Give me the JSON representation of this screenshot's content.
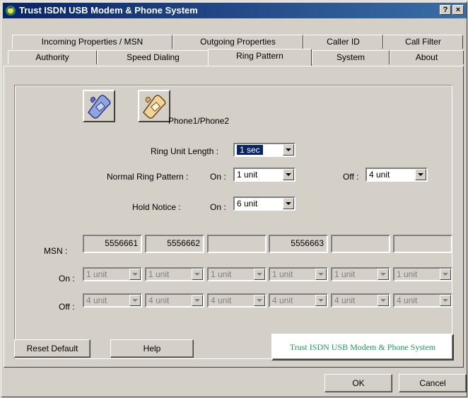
{
  "window": {
    "title": "Trust ISDN USB Modem & Phone System",
    "help_button": "?",
    "close_button": "×"
  },
  "tabs_row1": [
    "Incoming Properties / MSN",
    "Outgoing Properties",
    "Caller ID",
    "Call Filter"
  ],
  "tabs_row2": [
    "Authority",
    "Speed Dialing",
    "Ring Pattern",
    "System",
    "About"
  ],
  "active_tab": "Ring Pattern",
  "phone_label": "Phone1/Phone2",
  "ring_unit": {
    "label": "Ring Unit Length :",
    "value": "1 sec"
  },
  "normal_ring": {
    "label": "Normal Ring Pattern :",
    "on_label": "On :",
    "on_value": "1 unit",
    "off_label": "Off :",
    "off_value": "4 unit"
  },
  "hold_notice": {
    "label": "Hold Notice :",
    "on_label": "On :",
    "on_value": "6 unit"
  },
  "msn": {
    "label": "MSN :",
    "values": [
      "5556661",
      "5556662",
      "",
      "5556663",
      "",
      ""
    ],
    "on_label": "On :",
    "on_values": [
      "1 unit",
      "1 unit",
      "1 unit",
      "1 unit",
      "1 unit",
      "1 unit"
    ],
    "off_label": "Off :",
    "off_values": [
      "4 unit",
      "4 unit",
      "4 unit",
      "4 unit",
      "4 unit",
      "4 unit"
    ]
  },
  "buttons": {
    "reset": "Reset Default",
    "help": "Help",
    "banner": "Trust ISDN USB Modem & Phone System",
    "ok": "OK",
    "cancel": "Cancel"
  },
  "colors": {
    "titlebar": "#0a246a",
    "face": "#d4d0c8",
    "banner_text": "#1a9a5a"
  }
}
